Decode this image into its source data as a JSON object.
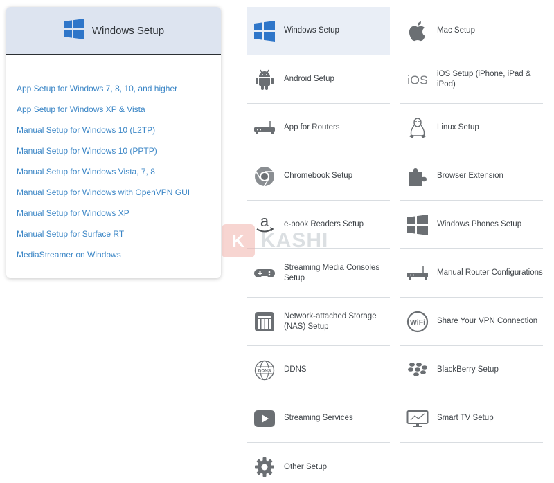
{
  "panel": {
    "title": "Windows Setup",
    "accent": "#2f76c9",
    "links": [
      "App Setup for Windows 7, 8, 10, and higher",
      "App Setup for Windows XP & Vista",
      "Manual Setup for Windows 10 (L2TP)",
      "Manual Setup for Windows 10 (PPTP)",
      "Manual Setup for Windows Vista, 7, 8",
      "Manual Setup for Windows with OpenVPN GUI",
      "Manual Setup for Windows XP",
      "Manual Setup for Surface RT",
      "MediaStreamer on Windows"
    ]
  },
  "grid": {
    "left": [
      {
        "label": "Windows Setup",
        "icon": "windows-icon",
        "active": true
      },
      {
        "label": "Android Setup",
        "icon": "android-icon"
      },
      {
        "label": "App for Routers",
        "icon": "router-icon"
      },
      {
        "label": "Chromebook Setup",
        "icon": "chrome-icon"
      },
      {
        "label": "e-book Readers Setup",
        "icon": "amazon-icon"
      },
      {
        "label": "Streaming Media Consoles Setup",
        "icon": "gamepad-icon"
      },
      {
        "label": "Network-attached Storage (NAS) Setup",
        "icon": "nas-icon"
      },
      {
        "label": "DDNS",
        "icon": "ddns-globe-icon",
        "icon_text": "DDNS"
      },
      {
        "label": "Streaming Services",
        "icon": "play-icon"
      },
      {
        "label": "Other Setup",
        "icon": "gear-icon"
      }
    ],
    "right": [
      {
        "label": "Mac Setup",
        "icon": "apple-icon"
      },
      {
        "label": "iOS Setup (iPhone, iPad & iPod)",
        "icon": "ios-icon",
        "icon_text": "iOS"
      },
      {
        "label": "Linux Setup",
        "icon": "linux-icon"
      },
      {
        "label": "Browser Extension",
        "icon": "puzzle-icon"
      },
      {
        "label": "Windows Phones Setup",
        "icon": "windows-phone-icon"
      },
      {
        "label": "Manual Router Configurations",
        "icon": "router-icon"
      },
      {
        "label": "Share Your VPN Connection",
        "icon": "wifi-icon",
        "icon_text": "WiFi"
      },
      {
        "label": "BlackBerry Setup",
        "icon": "blackberry-icon"
      },
      {
        "label": "Smart TV Setup",
        "icon": "tv-icon"
      }
    ]
  },
  "watermark": {
    "letter": "K",
    "text": "KASHI"
  }
}
